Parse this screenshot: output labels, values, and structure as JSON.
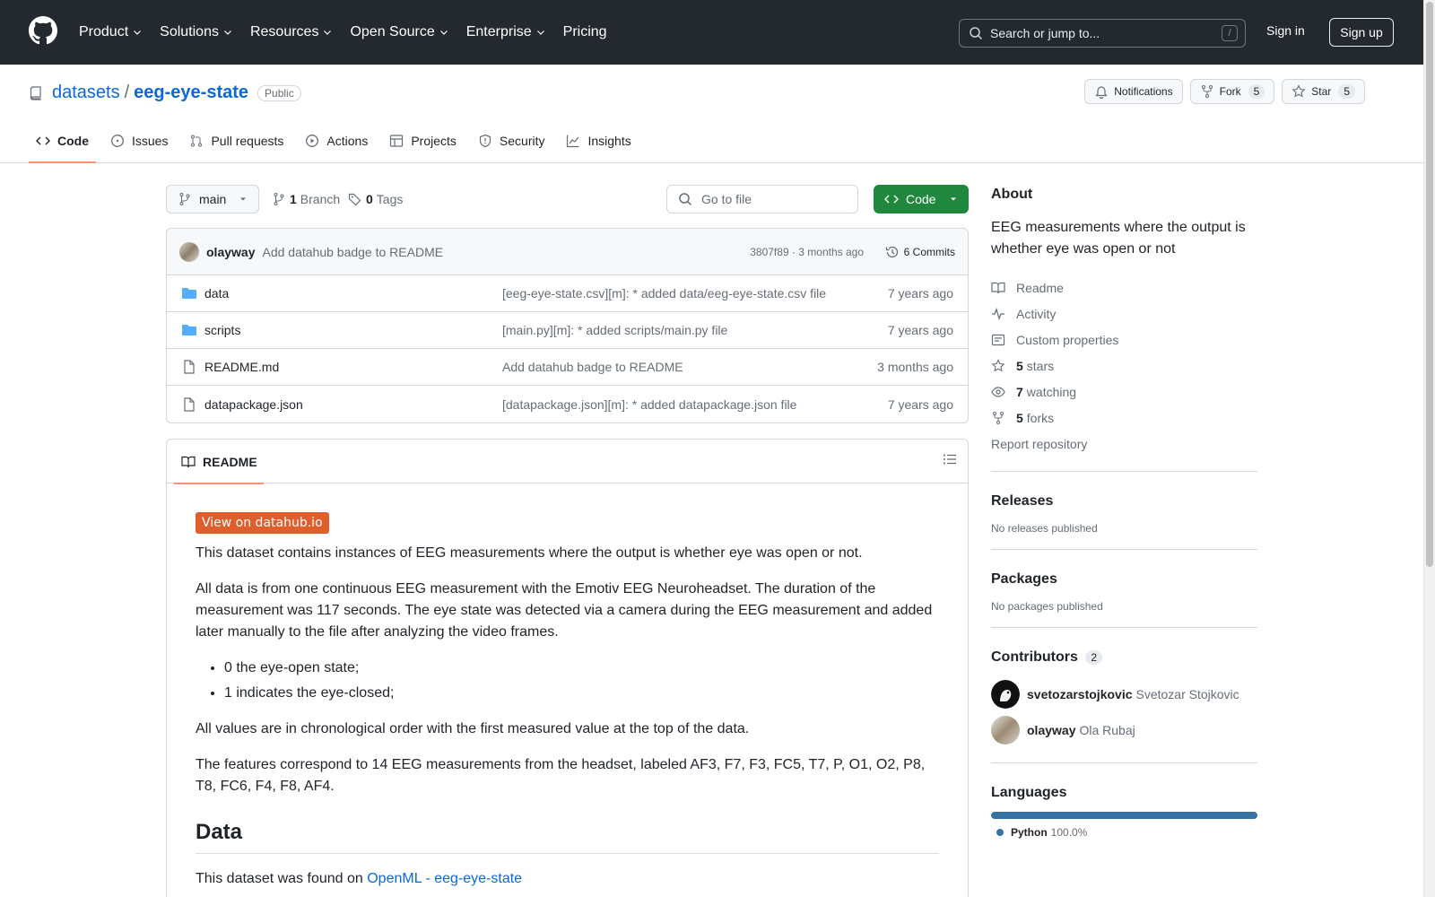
{
  "header": {
    "nav": [
      "Product",
      "Solutions",
      "Resources",
      "Open Source",
      "Enterprise",
      "Pricing"
    ],
    "search_placeholder": "Search or jump to...",
    "search_shortcut": "/",
    "sign_in": "Sign in",
    "sign_up": "Sign up"
  },
  "repo": {
    "owner": "datasets",
    "name": "eeg-eye-state",
    "visibility": "Public",
    "notifications_label": "Notifications",
    "fork_label": "Fork",
    "fork_count": "5",
    "star_label": "Star",
    "star_count": "5",
    "tabs": [
      "Code",
      "Issues",
      "Pull requests",
      "Actions",
      "Projects",
      "Security",
      "Insights"
    ]
  },
  "branch": {
    "current": "main",
    "branch_count": "1",
    "branch_label": "Branch",
    "tag_count": "0",
    "tag_label": "Tags",
    "goto_placeholder": "Go to file",
    "code_button": "Code"
  },
  "latest_commit": {
    "author": "olayway",
    "message": "Add datahub badge to README",
    "meta": "3807f89 · 3 months ago",
    "commits": "6 Commits"
  },
  "files": [
    {
      "type": "folder",
      "name": "data",
      "message": "[eeg-eye-state.csv][m]: * added data/eeg-eye-state.csv file",
      "age": "7 years ago"
    },
    {
      "type": "folder",
      "name": "scripts",
      "message": "[main.py][m]: * added scripts/main.py file",
      "age": "7 years ago"
    },
    {
      "type": "file",
      "name": "README.md",
      "message": "Add datahub badge to README",
      "age": "3 months ago"
    },
    {
      "type": "file",
      "name": "datapackage.json",
      "message": "[datapackage.json][m]: * added datapackage.json file",
      "age": "7 years ago"
    }
  ],
  "readme": {
    "tab_label": "README",
    "badge": "View on datahub.io",
    "p1": "This dataset contains instances of EEG measurements where the output is whether eye was open or not.",
    "p2": "All data is from one continuous EEG measurement with the Emotiv EEG Neuroheadset. The duration of the measurement was 117 seconds. The eye state was detected via a camera during the EEG measurement and added later manually to the file after analyzing the video frames.",
    "list": [
      "0 the eye-open state;",
      "1 indicates the eye-closed;"
    ],
    "p3": "All values are in chronological order with the first measured value at the top of the data.",
    "p4": "The features correspond to 14 EEG measurements from the headset, labeled AF3, F7, F3, FC5, T7, P, O1, O2, P8, T8, FC6, F4, F8, AF4.",
    "h_data": "Data",
    "p5_prefix": "This dataset was found on ",
    "p5_link": "OpenML - eeg-eye-state"
  },
  "sidebar": {
    "about_title": "About",
    "description": "EEG measurements where the output is whether eye was open or not",
    "readme": "Readme",
    "activity": "Activity",
    "custom_properties": "Custom properties",
    "stars_count": "5",
    "stars_label": "stars",
    "watching_count": "7",
    "watching_label": "watching",
    "forks_count": "5",
    "forks_label": "forks",
    "report": "Report repository",
    "releases_title": "Releases",
    "releases_empty": "No releases published",
    "packages_title": "Packages",
    "packages_empty": "No packages published",
    "contributors_title": "Contributors",
    "contributors_count": "2",
    "contributors": [
      {
        "login": "svetozarstojkovic",
        "name": "Svetozar Stojkovic"
      },
      {
        "login": "olayway",
        "name": "Ola Rubaj"
      }
    ],
    "languages_title": "Languages",
    "language_name": "Python",
    "language_percent": "100.0%",
    "language_color": "#3572A5"
  }
}
